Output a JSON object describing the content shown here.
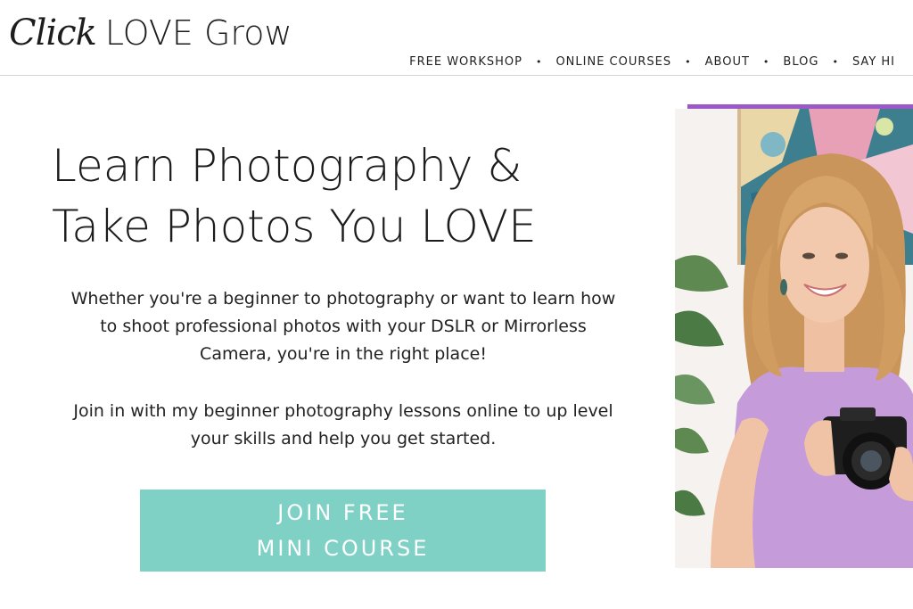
{
  "header": {
    "logo_script": "Click",
    "logo_main": "LOVE Grow",
    "nav": [
      {
        "label": "FREE WORKSHOP"
      },
      {
        "label": "ONLINE COURSES"
      },
      {
        "label": "ABOUT"
      },
      {
        "label": "BLOG"
      },
      {
        "label": "SAY HI"
      }
    ],
    "separator": "•"
  },
  "hero": {
    "headline_line1": "Learn Photography &",
    "headline_line2": "Take Photos You LOVE",
    "paragraph1": "Whether you're a beginner to photography or want to learn how to shoot professional photos with your DSLR or Mirrorless Camera, you're in the right place!",
    "paragraph2": "Join in with my beginner photography lessons online to up level your skills and help you get started.",
    "cta_line1": "JOIN FREE",
    "cta_line2": "MINI COURSE"
  },
  "colors": {
    "accent_teal": "#7fd1c6",
    "accent_purple": "#9b59c8",
    "text": "#222222"
  }
}
